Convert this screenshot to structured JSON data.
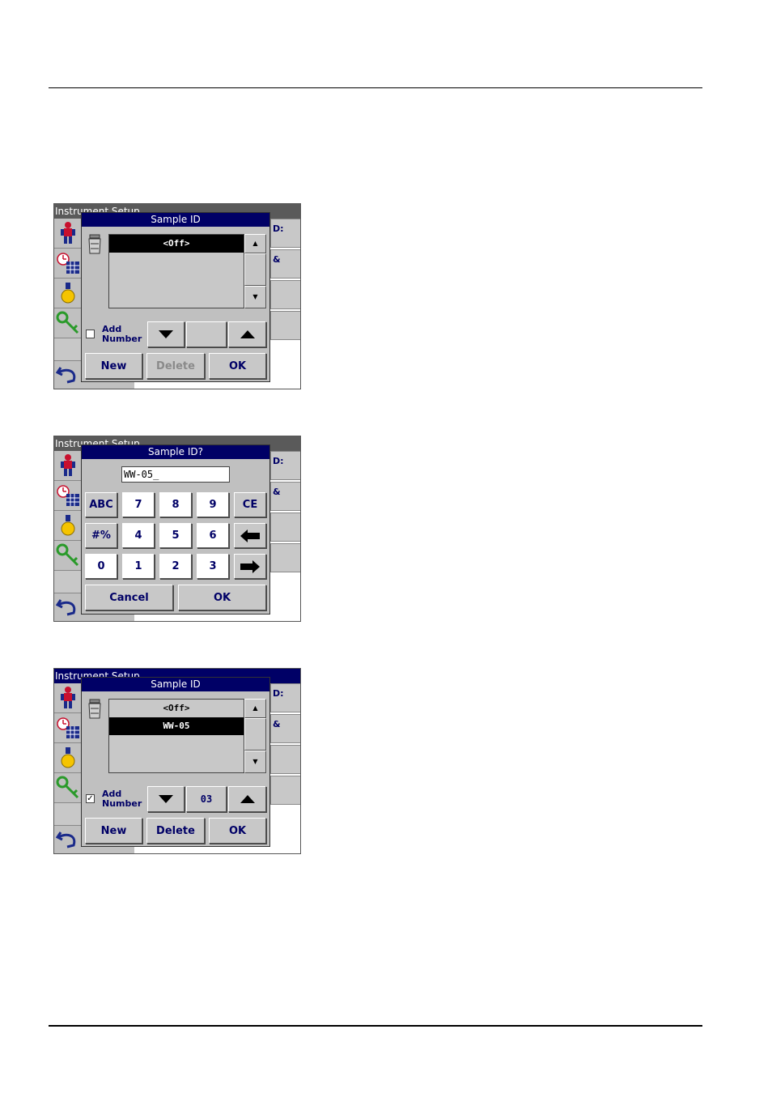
{
  "screens": [
    {
      "background_title": "Instrument Setup",
      "right_fragments": [
        "D:",
        "&",
        "",
        ""
      ],
      "dialog": {
        "title": "Sample ID",
        "list_items": [
          "<Off>"
        ],
        "selected_index": 0,
        "add_number_label_1": "Add",
        "add_number_label_2": "Number",
        "add_number_checked": false,
        "counter_value": "",
        "buttons": {
          "new": "New",
          "delete": "Delete",
          "ok": "OK"
        },
        "delete_enabled": false
      }
    },
    {
      "background_title": "Instrument Setup",
      "right_fragments": [
        "D:",
        "&",
        "",
        ""
      ],
      "dialog": {
        "title": "Sample ID?",
        "input_value": "WW-05_",
        "keypad_rows": [
          [
            "ABC",
            "7",
            "8",
            "9",
            "CE"
          ],
          [
            "#%",
            "4",
            "5",
            "6",
            "←"
          ],
          [
            "0",
            "1",
            "2",
            "3",
            "→"
          ]
        ],
        "buttons": {
          "cancel": "Cancel",
          "ok": "OK"
        }
      }
    },
    {
      "background_title": "Instrument Setup",
      "right_fragments": [
        "D:",
        "&",
        "",
        ""
      ],
      "dialog": {
        "title": "Sample ID",
        "list_items": [
          "<Off>",
          "WW-05"
        ],
        "selected_index": 1,
        "add_number_label_1": "Add",
        "add_number_label_2": "Number",
        "add_number_checked": true,
        "checkbox_mark": "✓",
        "counter_value": "03",
        "buttons": {
          "new": "New",
          "delete": "Delete",
          "ok": "OK"
        },
        "delete_enabled": true
      }
    }
  ],
  "colors": {
    "navy": "#000066",
    "gray": "#c0c0c0",
    "disabled_text": "#8a8a8a"
  }
}
